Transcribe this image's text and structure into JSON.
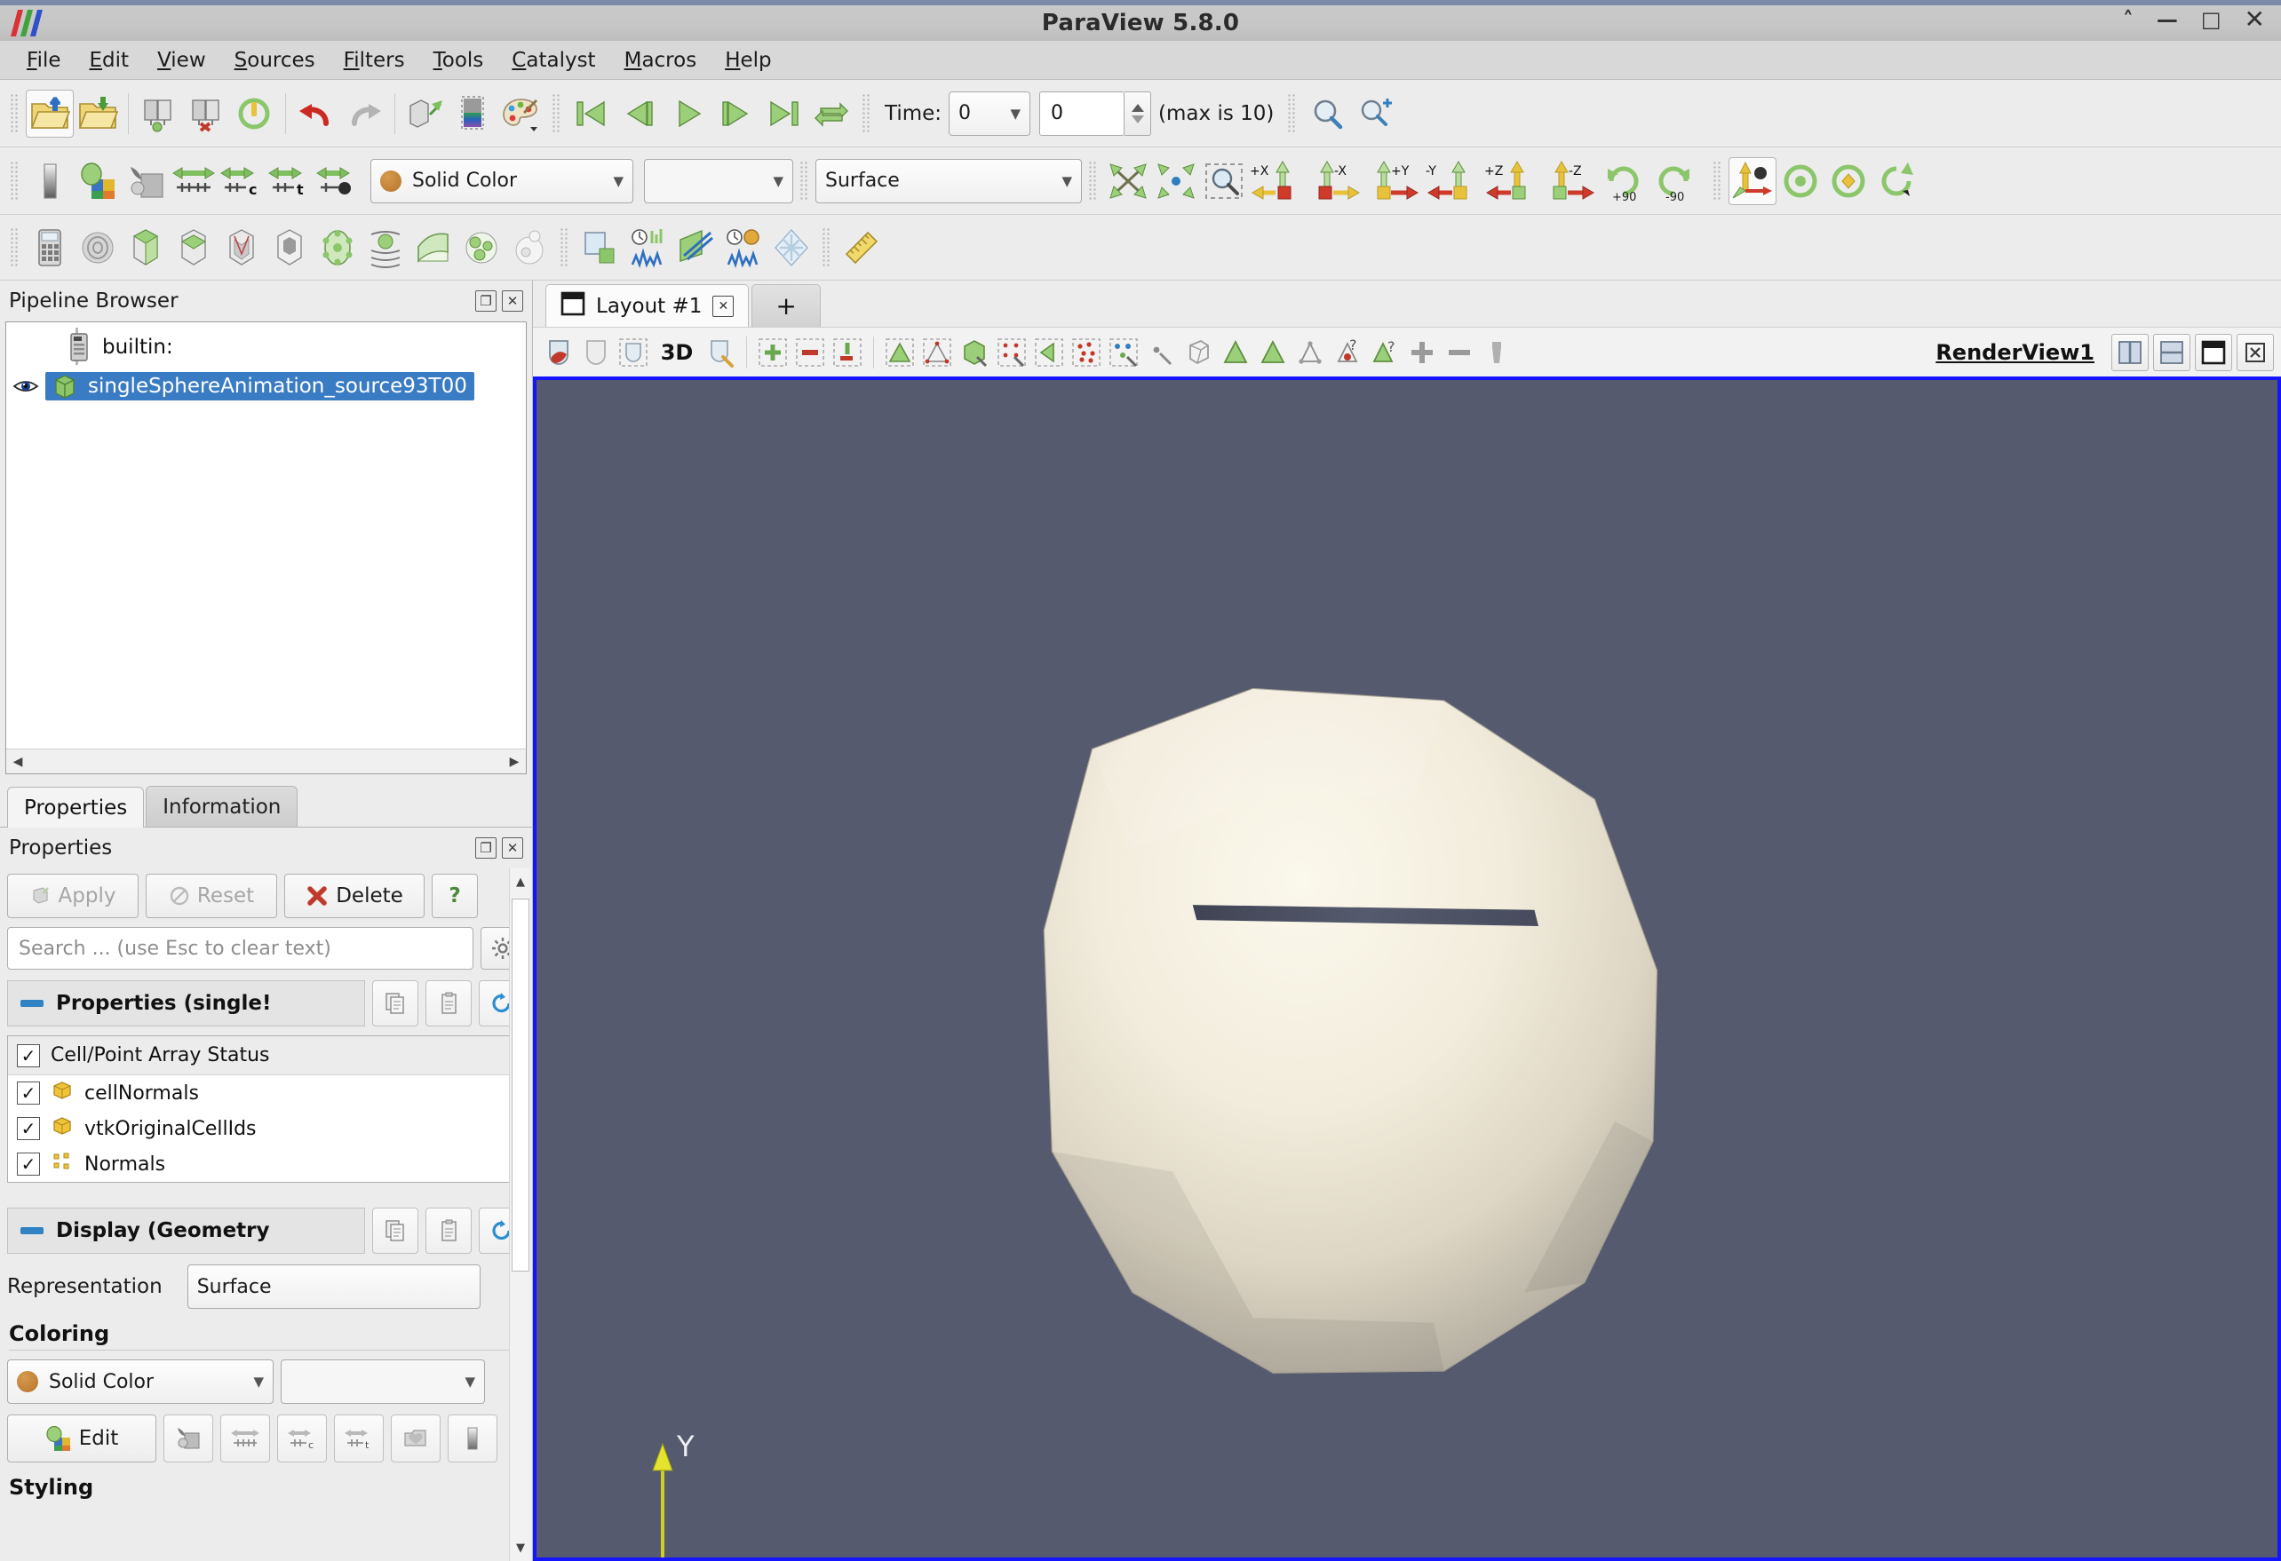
{
  "window": {
    "title": "ParaView 5.8.0",
    "controls": [
      {
        "name": "shade-window",
        "glyph": "˄"
      },
      {
        "name": "minimize-window",
        "glyph": "—"
      },
      {
        "name": "maximize-window",
        "glyph": "□"
      },
      {
        "name": "close-window",
        "glyph": "✕"
      }
    ]
  },
  "menubar": {
    "items": [
      {
        "label": "File",
        "mnemonic": "F",
        "rest": "ile"
      },
      {
        "label": "Edit",
        "mnemonic": "E",
        "rest": "dit"
      },
      {
        "label": "View",
        "mnemonic": "V",
        "rest": "iew"
      },
      {
        "label": "Sources",
        "mnemonic": "S",
        "rest": "ources"
      },
      {
        "label": "Filters",
        "mnemonic": "Fi",
        "rest": "lters"
      },
      {
        "label": "Tools",
        "mnemonic": "T",
        "rest": "ools"
      },
      {
        "label": "Catalyst",
        "mnemonic": "C",
        "rest": "atalyst"
      },
      {
        "label": "Macros",
        "mnemonic": "M",
        "rest": "acros"
      },
      {
        "label": "Help",
        "mnemonic": "H",
        "rest": "elp"
      }
    ]
  },
  "toolbar_main": {
    "icons": [
      "open-file-icon",
      "save-data-icon",
      "connect-server-icon",
      "disconnect-server-icon",
      "reset-session-icon",
      "undo-icon",
      "redo-icon",
      "undo-camera-icon",
      "redo-camera-icon",
      "color-palette-icon"
    ],
    "vcr": [
      "first-frame-icon",
      "previous-frame-icon",
      "play-icon",
      "next-frame-icon",
      "last-frame-icon",
      "loop-icon"
    ],
    "time_label": "Time:",
    "time_value": "0",
    "frame_value": "0",
    "max_label": "(max is 10)",
    "extra_icons": [
      "find-data-icon",
      "add-camera-link-icon"
    ]
  },
  "toolbar_repr": {
    "left_icons": [
      "colorbar-icon",
      "edit-color-map-icon",
      "edit-color-legend-icon",
      "rescale-range-data-icon",
      "rescale-range-custom-icon",
      "rescale-range-temporal-icon",
      "rescale-visible-range-icon"
    ],
    "color_by": "Solid Color",
    "color_by_swatch": "#b5742c",
    "array_component": "",
    "representation": "Surface",
    "camera_icons": [
      "reset-camera-icon",
      "zoom-to-data-icon",
      "zoom-to-box-icon",
      "plus-x-icon",
      "minus-x-icon",
      "plus-y-icon",
      "minus-y-icon",
      "plus-z-icon",
      "minus-z-icon",
      "rotate-90-cw-icon",
      "rotate-90-ccw-icon"
    ],
    "rotate_labels": [
      "+90",
      "-90"
    ],
    "axis_labels": [
      "+X",
      "-X",
      "+Y",
      "-Y",
      "+Z",
      "-Z"
    ],
    "right_icons": [
      "center-axes-icon",
      "reset-center-icon",
      "pick-center-icon",
      "show-orientation-axes-icon"
    ]
  },
  "toolbar_filters": {
    "icons": [
      "calculator-icon",
      "contour-icon",
      "clip-icon",
      "slice-icon",
      "threshold-icon",
      "extract-subset-icon",
      "glyph-icon",
      "stream-tracer-icon",
      "warp-icon",
      "group-datasets-icon",
      "extract-level-icon",
      "plot-over-line-icon",
      "plot-selection-icon",
      "plot-data-icon",
      "plot-selection-over-time-icon",
      "spreadsheet-icon",
      "ruler-icon"
    ]
  },
  "pipeline_browser": {
    "title": "Pipeline Browser",
    "header_buttons": [
      "undock-icon",
      "close-icon"
    ],
    "items": [
      {
        "label": "builtin:",
        "icon": "server-icon",
        "selected": false,
        "visible": false
      },
      {
        "label": "singleSphereAnimation_source93T00",
        "icon": "source-icon",
        "selected": true,
        "visible": true
      }
    ]
  },
  "properties_panel": {
    "tabs": [
      {
        "label": "Properties",
        "active": true
      },
      {
        "label": "Information",
        "active": false
      }
    ],
    "title": "Properties",
    "header_buttons": [
      "undock-icon",
      "close-icon"
    ],
    "buttons": [
      {
        "label": "Apply",
        "name": "apply-button",
        "disabled": true,
        "icon": "apply-icon"
      },
      {
        "label": "Reset",
        "name": "reset-button",
        "disabled": true,
        "icon": "reset-icon"
      },
      {
        "label": "Delete",
        "name": "delete-button",
        "disabled": false,
        "icon": "delete-icon"
      },
      {
        "label": "?",
        "name": "help-button",
        "disabled": false,
        "icon": "help-icon"
      }
    ],
    "search_placeholder": "Search ... (use Esc to clear text)",
    "gear_icon": "advanced-properties-icon",
    "section_properties": "Properties (single!",
    "section_display": "Display (Geometry",
    "section_buttons": [
      "copy-icon",
      "paste-icon",
      "restore-defaults-icon"
    ],
    "array_status": {
      "header": "Cell/Point Array Status",
      "header_checked": true,
      "rows": [
        {
          "label": "cellNormals",
          "checked": true,
          "icon": "cell-data-icon"
        },
        {
          "label": "vtkOriginalCellIds",
          "checked": true,
          "icon": "cell-data-icon"
        },
        {
          "label": "Normals",
          "checked": true,
          "icon": "point-data-icon"
        }
      ]
    },
    "representation_label": "Representation",
    "representation_value": "Surface",
    "coloring_label": "Coloring",
    "coloring_value": "Solid Color",
    "coloring_swatch": "#b5742c",
    "edit_label": "Edit",
    "coloring_icons": [
      "edit-color-map-icon",
      "rescale-range-data-icon",
      "rescale-range-custom-icon",
      "rescale-range-temporal-icon",
      "choose-preset-icon",
      "color-legend-icon"
    ],
    "styling_label": "Styling"
  },
  "layout": {
    "tabs": [
      {
        "label": "Layout #1",
        "active": true,
        "closable": true
      },
      {
        "label": "+",
        "active": false,
        "closable": false
      }
    ]
  },
  "view_toolbar": {
    "icons": [
      "interact-icon",
      "select-cells-on-icon",
      "select-points-on-icon",
      "3d-label",
      "zoom-to-box-icon",
      "select-cells-through-icon",
      "select-points-through-icon",
      "select-block-icon",
      "frustum-cells-icon",
      "frustum-points-icon",
      "select-cells-polygon-icon",
      "select-points-polygon-icon",
      "interactive-select-cells-icon",
      "interactive-select-points-icon",
      "hover-cells-icon",
      "hover-points-icon",
      "grow-selection-icon",
      "shrink-selection-icon",
      "clear-selection-icon",
      "extract-selection-icon",
      "plot-selection-icon",
      "freeze-selection-icon",
      "add-selection-icon",
      "subtract-selection-icon",
      "toggle-selection-icon"
    ],
    "label_3d": "3D",
    "view_name": "RenderView1",
    "view_buttons": [
      "split-horizontal-icon",
      "split-vertical-icon",
      "maximize-view-icon",
      "close-view-icon"
    ]
  },
  "render_view": {
    "background_color": "#565a6e",
    "border_color": "#1414ff",
    "orientation_axes": [
      {
        "label": "Y",
        "color": "#dede28"
      }
    ],
    "object": "polygonal-sphere"
  }
}
